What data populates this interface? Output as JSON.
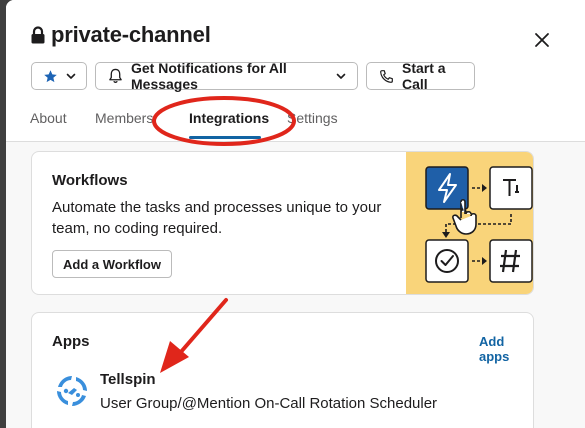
{
  "header": {
    "title": "private-channel",
    "notifications_label": "Get Notifications for All Messages",
    "call_label": "Start a Call"
  },
  "tabs": [
    {
      "label": "About"
    },
    {
      "label": "Members"
    },
    {
      "label": "Integrations"
    },
    {
      "label": "Settings"
    }
  ],
  "workflows": {
    "title": "Workflows",
    "description": "Automate the tasks and processes unique to your team, no coding required.",
    "button_label": "Add a Workflow"
  },
  "apps": {
    "title": "Apps",
    "add_label": "Add apps",
    "items": [
      {
        "name": "Tellspin",
        "description": "User Group/@Mention On-Call Rotation Scheduler"
      }
    ]
  },
  "colors": {
    "accent": "#1264a3",
    "annotation": "#e0261b",
    "workflow_bg": "#f9d47a",
    "workflow_tile": "#1f5fa8",
    "star": "#1d64b5"
  },
  "icons": [
    "lock-icon",
    "close-icon",
    "star-icon",
    "chevron-down-icon",
    "bell-icon",
    "phone-icon",
    "lightning-icon",
    "hand-cursor-icon",
    "checkmark-icon",
    "hash-icon",
    "text-icon",
    "tellspin-icon"
  ]
}
